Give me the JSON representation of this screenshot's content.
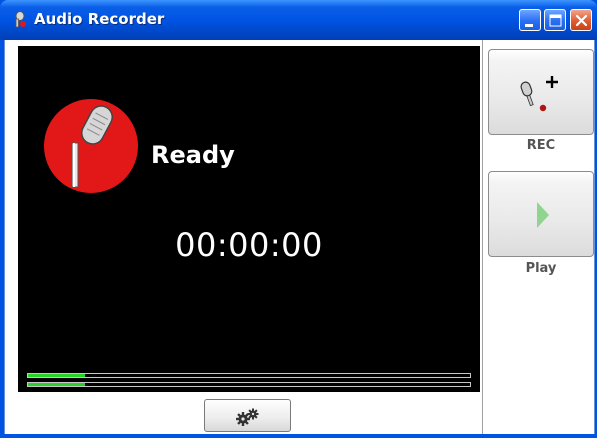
{
  "window": {
    "title": "Audio Recorder",
    "icon": "microphone-icon"
  },
  "titlebar_buttons": {
    "minimize_icon": "minimize-icon",
    "maximize_icon": "maximize-icon",
    "close_icon": "close-icon"
  },
  "display": {
    "status": "Ready",
    "time": "00:00:00",
    "mic_icon": "microphone-icon",
    "level_meters": [
      {
        "channel": "left",
        "level": 0.13
      },
      {
        "channel": "right",
        "level": 0.13
      }
    ],
    "colors": {
      "background": "#000000",
      "mic_circle": "#e21818",
      "level": "#2bd12b"
    }
  },
  "settings": {
    "icon": "gears-icon"
  },
  "sidebar": {
    "rec": {
      "label": "REC",
      "icon": "microphone-add-icon"
    },
    "play": {
      "label": "Play",
      "icon": "play-icon",
      "accent": "#8fd48f"
    }
  }
}
